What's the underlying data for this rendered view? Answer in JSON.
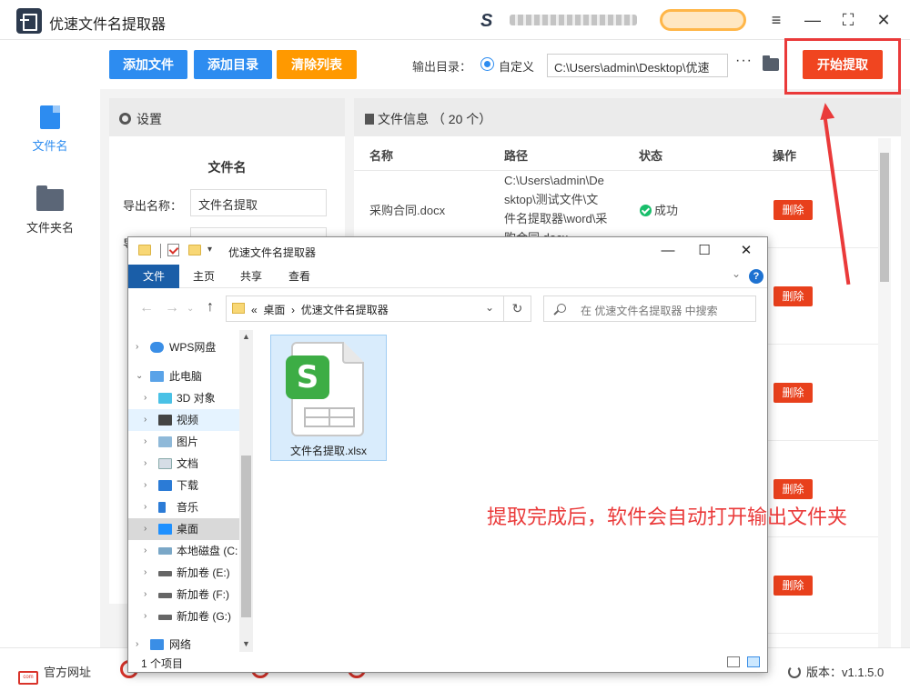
{
  "app": {
    "title": "优速文件名提取器",
    "promo_letter": "S"
  },
  "window_controls": {
    "menu": "≡",
    "minimize": "—",
    "maximize": "⛶",
    "close": "✕"
  },
  "sidebar": {
    "items": [
      {
        "label": "文件名",
        "icon": "file-icon",
        "active": true
      },
      {
        "label": "文件夹名",
        "icon": "folder-icon",
        "active": false
      }
    ]
  },
  "toolbar": {
    "add_file": "添加文件",
    "add_dir": "添加目录",
    "clear_list": "清除列表",
    "output_label": "输出目录：",
    "custom_label": "自定义",
    "output_path": "C:\\Users\\admin\\Desktop\\优速",
    "more": "···",
    "start": "开始提取"
  },
  "settings": {
    "header": "设置",
    "section": "文件名",
    "export_name_label": "导出名称：",
    "export_name_value": "文件名提取",
    "second_label": "导"
  },
  "fileinfo": {
    "header": "文件信息 （ 20 个）",
    "columns": {
      "name": "名称",
      "path": "路径",
      "status": "状态",
      "action": "操作"
    },
    "rows": [
      {
        "name": "采购合同.docx",
        "path": "C:\\Users\\admin\\Desktop\\测试文件\\文件名提取器\\word\\采购合同.docx",
        "status": "成功",
        "action": "删除"
      },
      {
        "action": "删除"
      },
      {
        "action": "删除"
      },
      {
        "action": "删除"
      },
      {
        "action": "删除"
      }
    ]
  },
  "footer": {
    "website": "官方网址",
    "version": "版本：v1.1.5.0"
  },
  "explorer": {
    "title": "优速文件名提取器",
    "ribbon_tabs": [
      "文件",
      "主页",
      "共享",
      "查看"
    ],
    "address_prefix": "«",
    "address_parts": [
      "桌面",
      "优速文件名提取器"
    ],
    "search_placeholder": "在 优速文件名提取器 中搜索",
    "nav_items": [
      {
        "label": "WPS网盘",
        "icon": "cloud-icon"
      },
      {
        "label": "此电脑",
        "icon": "computer-icon"
      },
      {
        "label": "3D 对象",
        "icon": "cube-icon"
      },
      {
        "label": "视频",
        "icon": "video-icon"
      },
      {
        "label": "图片",
        "icon": "picture-icon"
      },
      {
        "label": "文档",
        "icon": "document-icon"
      },
      {
        "label": "下载",
        "icon": "download-icon"
      },
      {
        "label": "音乐",
        "icon": "music-icon"
      },
      {
        "label": "桌面",
        "icon": "desktop-icon"
      },
      {
        "label": "本地磁盘 (C:",
        "icon": "drive-icon"
      },
      {
        "label": "新加卷 (E:)",
        "icon": "drive-icon"
      },
      {
        "label": "新加卷 (F:)",
        "icon": "drive-icon"
      },
      {
        "label": "新加卷 (G:)",
        "icon": "drive-icon"
      },
      {
        "label": "网络",
        "icon": "network-icon"
      }
    ],
    "file": {
      "name": "文件名提取.xlsx",
      "badge": "S"
    },
    "status_count": "1 个项目"
  },
  "annotation": "提取完成后，软件会自动打开输出文件夹",
  "colors": {
    "primary_blue": "#2d8cf0",
    "orange": "#ff9900",
    "red": "#f04520",
    "annotation_red": "#ea3a3a",
    "success_green": "#19be6b"
  }
}
